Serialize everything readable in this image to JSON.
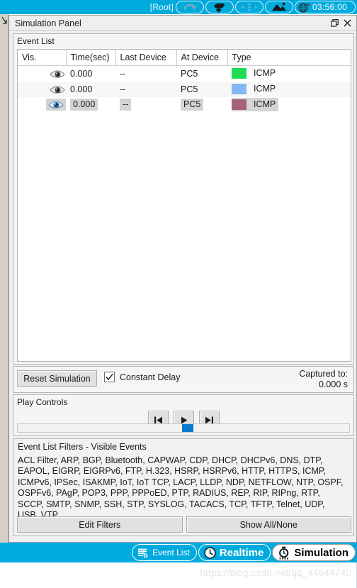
{
  "toolbar": {
    "root_label": "[Root]",
    "buttons": [
      {
        "name": "undo-icon",
        "title": "Undo"
      },
      {
        "name": "add-cloud-icon",
        "title": "Add Simple PDU"
      },
      {
        "name": "move-layout-icon",
        "title": "Move Layout"
      },
      {
        "name": "set-background-icon",
        "title": "Set Tiled Background"
      },
      {
        "name": "viewport-icon",
        "title": "Viewport"
      }
    ],
    "clock": "03:56:00"
  },
  "window": {
    "title": "Simulation Panel",
    "restore_label": "❐",
    "close_label": "✕"
  },
  "event_list": {
    "group_title": "Event List",
    "columns": [
      "Vis.",
      "Time(sec)",
      "Last Device",
      "At Device",
      "Type"
    ],
    "rows": [
      {
        "vis": "eye-icon",
        "time": "0.000",
        "last_device": "--",
        "at_device": "PC5",
        "color": "#1FDC53",
        "type": "ICMP",
        "selected": false
      },
      {
        "vis": "eye-icon",
        "time": "0.000",
        "last_device": "--",
        "at_device": "PC5",
        "color": "#85B6F5",
        "type": "ICMP",
        "selected": false
      },
      {
        "vis": "eye-icon",
        "time": "0.000",
        "last_device": "--",
        "at_device": "PC5",
        "color": "#A5627A",
        "type": "ICMP",
        "selected": true
      }
    ]
  },
  "reset_bar": {
    "reset_label": "Reset Simulation",
    "constant_delay_label": "Constant Delay",
    "constant_delay_checked": true,
    "captured_label": "Captured to:",
    "captured_value": "0.000 s"
  },
  "play_controls": {
    "group_title": "Play Controls",
    "back_label": "⏮",
    "play_label": "▶",
    "forward_label": "⏭",
    "scroll_position_pct": 50
  },
  "filters": {
    "title": "Event List Filters - Visible Events",
    "visible_events": "ACL Filter, ARP, BGP, Bluetooth, CAPWAP, CDP, DHCP, DHCPv6, DNS, DTP, EAPOL, EIGRP, EIGRPv6, FTP, H.323, HSRP, HSRPv6, HTTP, HTTPS, ICMP, ICMPv6, IPSec, ISAKMP, IoT, IoT TCP, LACP, LLDP, NDP, NETFLOW, NTP, OSPF, OSPFv6, PAgP, POP3, PPP, PPPoED, PTP, RADIUS, REP, RIP, RIPng, RTP, SCCP, SMTP, SNMP, SSH, STP, SYSLOG, TACACS, TCP, TFTP, Telnet, UDP, USB, VTP",
    "edit_filters_label": "Edit Filters",
    "show_all_none_label": "Show All/None"
  },
  "bottom_bar": {
    "event_list_label": "Event List",
    "realtime_label": "Realtime",
    "simulation_label": "Simulation",
    "active_mode": "Simulation"
  },
  "watermark": {
    "text": "https://blog.csdn.net/qq_44644740"
  },
  "colors": {
    "cyan": "#00AADD",
    "selection": "#d4d4d4",
    "accent_blue": "#0a7ACB"
  }
}
